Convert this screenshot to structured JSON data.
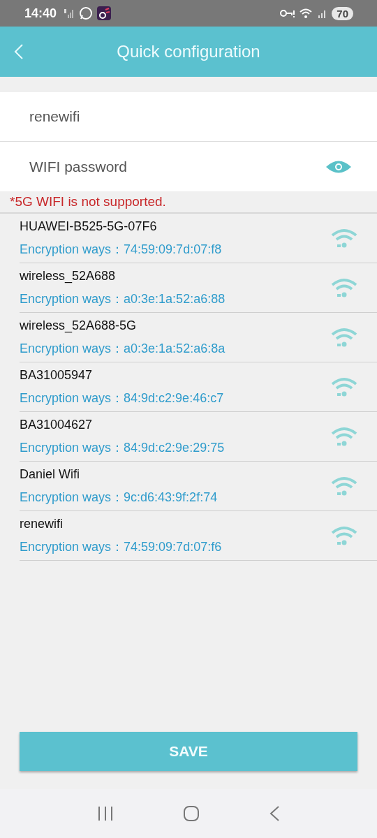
{
  "status_bar": {
    "time": "14:40",
    "battery": "70"
  },
  "header": {
    "title": "Quick configuration"
  },
  "form": {
    "ssid": {
      "value": "renewifi"
    },
    "password": {
      "placeholder": "WIFI password"
    },
    "warning": "*5G WIFI is not supported."
  },
  "networks": [
    {
      "name": "HUAWEI-B525-5G-07F6",
      "detail": "Encryption ways：74:59:09:7d:07:f8"
    },
    {
      "name": "wireless_52A688",
      "detail": "Encryption ways：a0:3e:1a:52:a6:88"
    },
    {
      "name": "wireless_52A688-5G",
      "detail": "Encryption ways：a0:3e:1a:52:a6:8a"
    },
    {
      "name": "BA31005947",
      "detail": "Encryption ways：84:9d:c2:9e:46:c7"
    },
    {
      "name": "BA31004627",
      "detail": "Encryption ways：84:9d:c2:9e:29:75"
    },
    {
      "name": "Daniel Wifi",
      "detail": "Encryption ways：9c:d6:43:9f:2f:74"
    },
    {
      "name": "renewifi",
      "detail": "Encryption ways：74:59:09:7d:07:f6"
    }
  ],
  "save_button": "SAVE"
}
